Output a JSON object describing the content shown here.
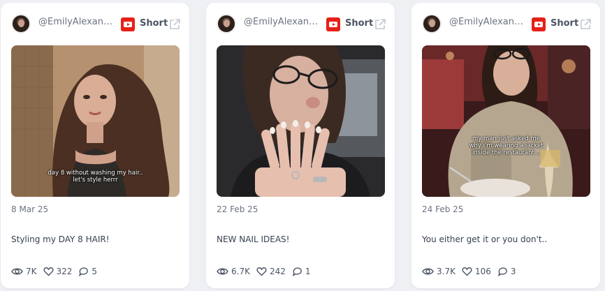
{
  "cards": [
    {
      "handle": "@EmilyAlexand...",
      "platform_label": "Short",
      "platform_icon": "youtube-icon",
      "thumbnail_caption_line1": "day 8 without washing my hair..",
      "thumbnail_caption_line2": "let's style herrr",
      "date": "8 Mar 25",
      "title": "Styling my DAY 8 HAIR!",
      "views": "7K",
      "likes": "322",
      "comments": "5"
    },
    {
      "handle": "@EmilyAlexand...",
      "platform_label": "Short",
      "platform_icon": "youtube-icon",
      "date": "22 Feb 25",
      "title": "NEW NAIL IDEAS!",
      "views": "6.7K",
      "likes": "242",
      "comments": "1"
    },
    {
      "handle": "@EmilyAlexand...",
      "platform_label": "Short",
      "platform_icon": "youtube-icon",
      "thumbnail_caption_line1": "my man just asked me",
      "thumbnail_caption_line2": "why i'm wearing a jacket",
      "thumbnail_caption_line3": "inside the restaurant ..",
      "date": "24 Feb 25",
      "title": "You either get it or you don't..",
      "views": "3.7K",
      "likes": "106",
      "comments": "3"
    }
  ],
  "colors": {
    "youtube_red": "#e62117",
    "text_muted": "#6b7280",
    "text_main": "#374151",
    "background": "#eef0f4"
  }
}
